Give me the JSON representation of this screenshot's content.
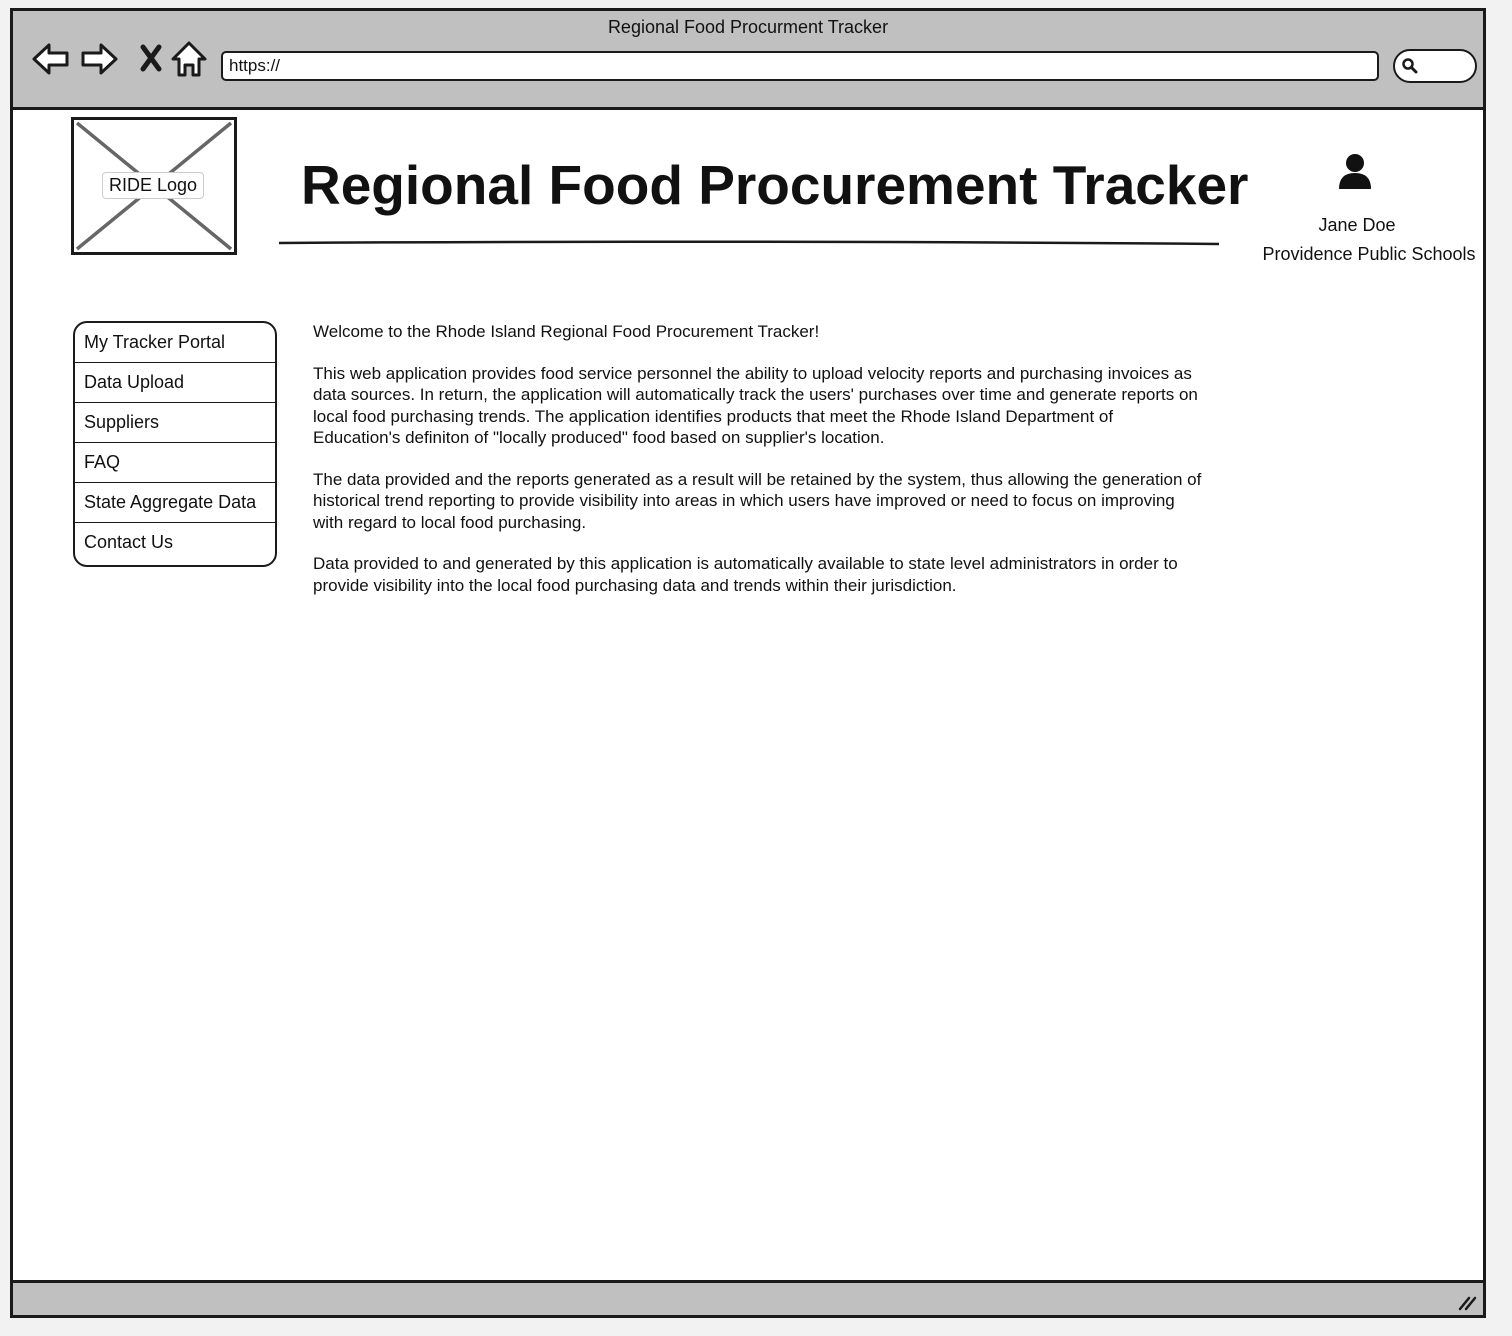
{
  "browser": {
    "window_title": "Regional Food Procurment Tracker",
    "url": "https://",
    "icons": [
      "back-arrow-icon",
      "forward-arrow-icon",
      "stop-icon",
      "home-icon",
      "search-icon",
      "resize-grip-icon"
    ]
  },
  "header": {
    "logo_label": "RIDE Logo",
    "title": "Regional Food Procurement Tracker"
  },
  "user": {
    "icon": "user-icon",
    "name": "Jane Doe",
    "organization": "Providence Public Schools"
  },
  "sidebar": {
    "items": [
      {
        "label": "My Tracker Portal"
      },
      {
        "label": "Data Upload"
      },
      {
        "label": "Suppliers"
      },
      {
        "label": "FAQ"
      },
      {
        "label": "State Aggregate Data"
      },
      {
        "label": "Contact Us"
      }
    ]
  },
  "main": {
    "welcome": "Welcome to the Rhode Island Regional Food Procurement Tracker!",
    "paragraphs": [
      "This web application provides food service personnel the ability to upload velocity reports and purchasing invoices as data sources. In return, the application will automatically track the users' purchases over time and generate reports on local food purchasing trends. The application identifies products that meet the Rhode Island Department of Education's definiton of \"locally produced\" food based on supplier's location.",
      "The data provided and the reports generated as a result will be retained by the system, thus allowing the generation of historical trend reporting to provide visibility into areas in which users have improved or need to focus on improving with regard to local food purchasing.",
      "Data provided to and generated by this application is automatically available to state level administrators in order to provide visibility into the local food purchasing data and trends within their jurisdiction."
    ]
  },
  "colors": {
    "chrome": "#c0c0c0",
    "border": "#1a1a1a",
    "background": "#ffffff"
  }
}
